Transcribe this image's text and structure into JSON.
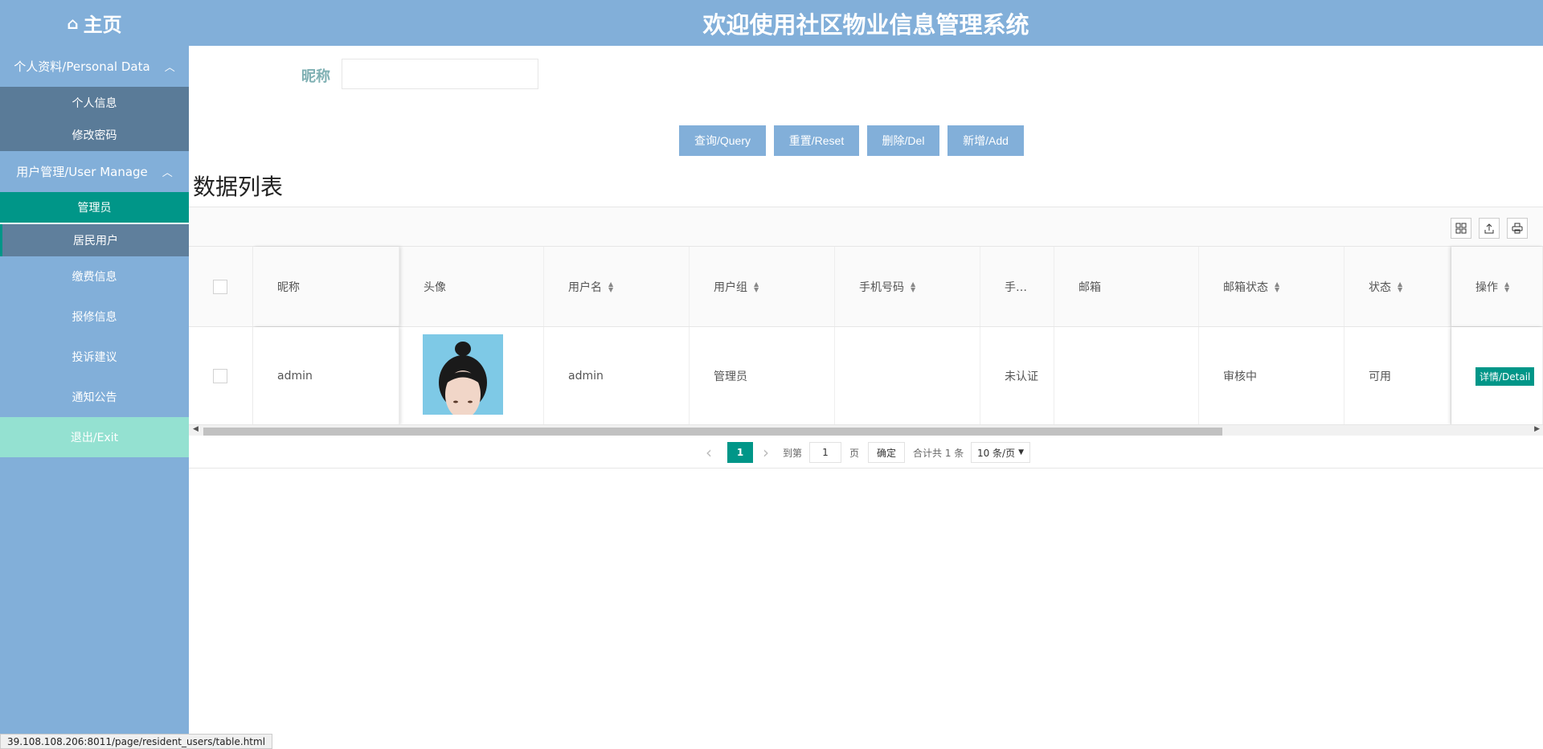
{
  "header": {
    "home_icon": "⌂",
    "home_label": "主页",
    "title": "欢迎使用社区物业信息管理系统"
  },
  "sidebar": {
    "group1": {
      "label": "个人资料/Personal Data",
      "chevron": "︿"
    },
    "group1_items": [
      "个人信息",
      "修改密码"
    ],
    "group2": {
      "label": "用户管理/User Manage",
      "chevron": "︿"
    },
    "group2_items": [
      "管理员",
      "居民用户"
    ],
    "items": [
      "缴费信息",
      "报修信息",
      "投诉建议",
      "通知公告"
    ],
    "exit": "退出/Exit"
  },
  "search": {
    "label": "昵称",
    "value": ""
  },
  "buttons": {
    "query": "查询/Query",
    "reset": "重置/Reset",
    "delete": "删除/Del",
    "add": "新增/Add"
  },
  "list_title": "数据列表",
  "toolbar_icons": [
    "columns-icon",
    "export-icon",
    "print-icon"
  ],
  "table": {
    "headers": {
      "nickname": "昵称",
      "avatar": "头像",
      "username": "用户名",
      "group": "用户组",
      "phone": "手机号码",
      "phone_status": "手…",
      "email": "邮箱",
      "email_status": "邮箱状态",
      "state": "状态",
      "action": "操作"
    },
    "rows": [
      {
        "nickname": "admin",
        "username": "admin",
        "group": "管理员",
        "phone": "",
        "phone_status": "未认证",
        "email": "",
        "email_status": "审核中",
        "state": "可用",
        "action": "详情/Detail"
      }
    ]
  },
  "pager": {
    "prev": "‹",
    "current": "1",
    "next": "›",
    "goto_label": "到第",
    "goto_value": "1",
    "page_unit": "页",
    "confirm": "确定",
    "total": "合计共 1 条",
    "page_size": "10 条/页"
  },
  "status_url": "39.108.108.206:8011/page/resident_users/table.html",
  "colors": {
    "primary": "#82afd9",
    "accent": "#009688",
    "exit": "#94e1d1"
  }
}
